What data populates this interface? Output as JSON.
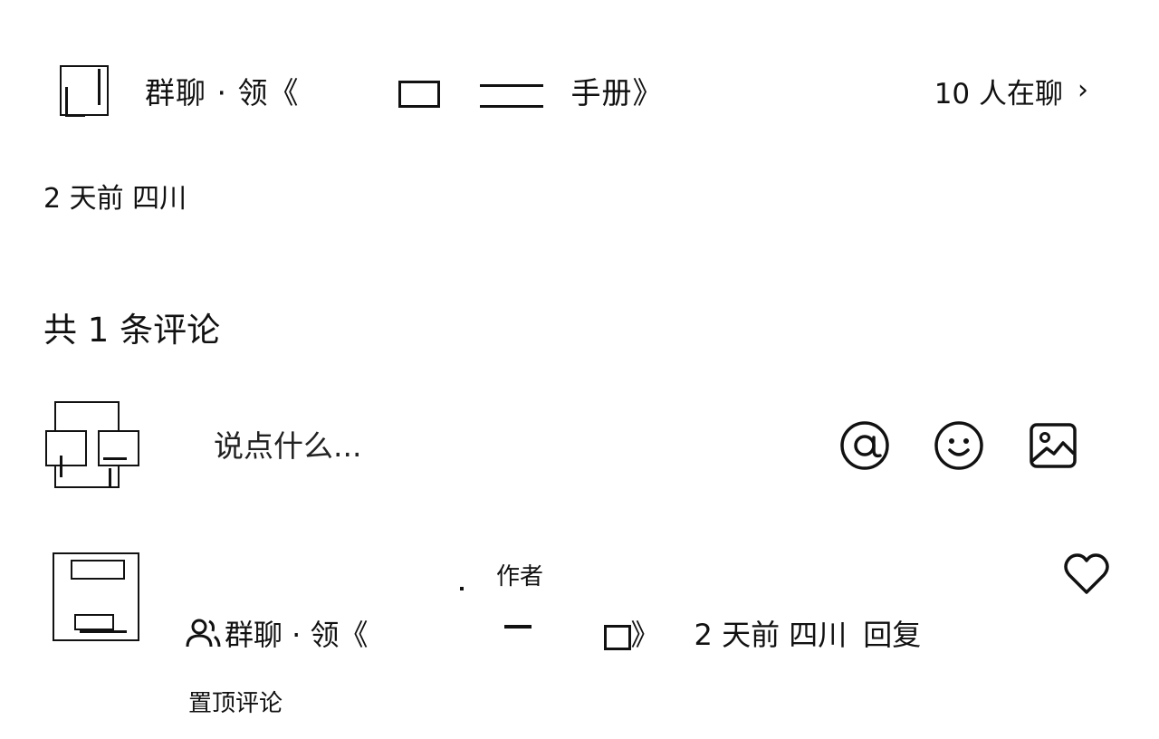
{
  "group_chat": {
    "prefix": "群聊 · 领《",
    "suffix": "手册》",
    "member_count": "10 人在聊",
    "chevron": "›",
    "icon": "chevron-right-icon"
  },
  "post_meta": "2 天前 四川",
  "comment_count": "共 1 条评论",
  "comment_input": {
    "placeholder": "说点什么..."
  },
  "tools": {
    "mention_icon": "at-icon",
    "emoji_icon": "smiley-icon",
    "image_icon": "image-icon"
  },
  "comment": {
    "author_tag": "作者",
    "group_prefix": "群聊 · 领《",
    "group_suffix": "》",
    "time_location": "2 天前 四川",
    "reply": "回复",
    "pinned": "置顶评论",
    "like_icon": "heart-icon",
    "group_icon": "user-icon"
  }
}
